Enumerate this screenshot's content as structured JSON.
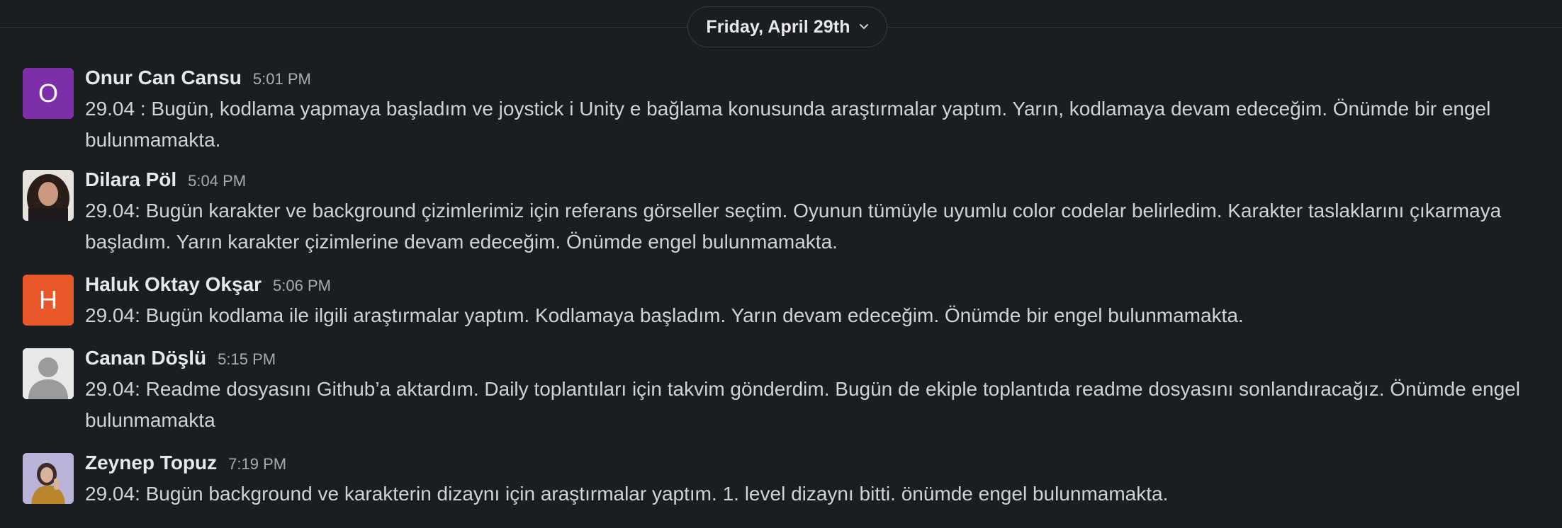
{
  "date_divider": {
    "label": "Friday, April 29th",
    "icon": "chevron-down-icon"
  },
  "colors": {
    "background": "#1a1d21",
    "avatar_onur": "#7c2fa8",
    "avatar_haluk": "#e8572a",
    "avatar_generic": "#e8e8e8"
  },
  "messages": [
    {
      "sender": "Onur Can Cansu",
      "time": "5:01 PM",
      "avatar_letter": "O",
      "text": "29.04 : Bugün, kodlama yapmaya başladım ve joystick i Unity e bağlama konusunda araştırmalar yaptım. Yarın, kodlamaya devam edeceğim. Önümde bir engel bulunmamakta."
    },
    {
      "sender": "Dilara Pöl",
      "time": "5:04 PM",
      "avatar_letter": "",
      "text": "29.04: Bugün karakter ve background çizimlerimiz  için referans görseller seçtim. Oyunun tümüyle uyumlu color codelar belirledim. Karakter taslaklarını çıkarmaya başladım. Yarın karakter çizimlerine devam edeceğim. Önümde engel bulunmamakta."
    },
    {
      "sender": "Haluk Oktay Okşar",
      "time": "5:06 PM",
      "avatar_letter": "H",
      "text": "29.04: Bugün kodlama ile ilgili araştırmalar yaptım. Kodlamaya başladım. Yarın devam edeceğim. Önümde bir engel bulunmamakta."
    },
    {
      "sender": "Canan Döşlü",
      "time": "5:15 PM",
      "avatar_letter": "",
      "text": "29.04: Readme dosyasını Github’a aktardım. Daily toplantıları için takvim gönderdim. Bugün de ekiple toplantıda readme dosyasını sonlandıracağız. Önümde engel bulunmamakta"
    },
    {
      "sender": "Zeynep Topuz",
      "time": "7:19 PM",
      "avatar_letter": "",
      "text": "29.04: Bugün background ve karakterin dizaynı için araştırmalar yaptım. 1. level dizaynı bitti. önümde engel bulunmamakta."
    }
  ]
}
